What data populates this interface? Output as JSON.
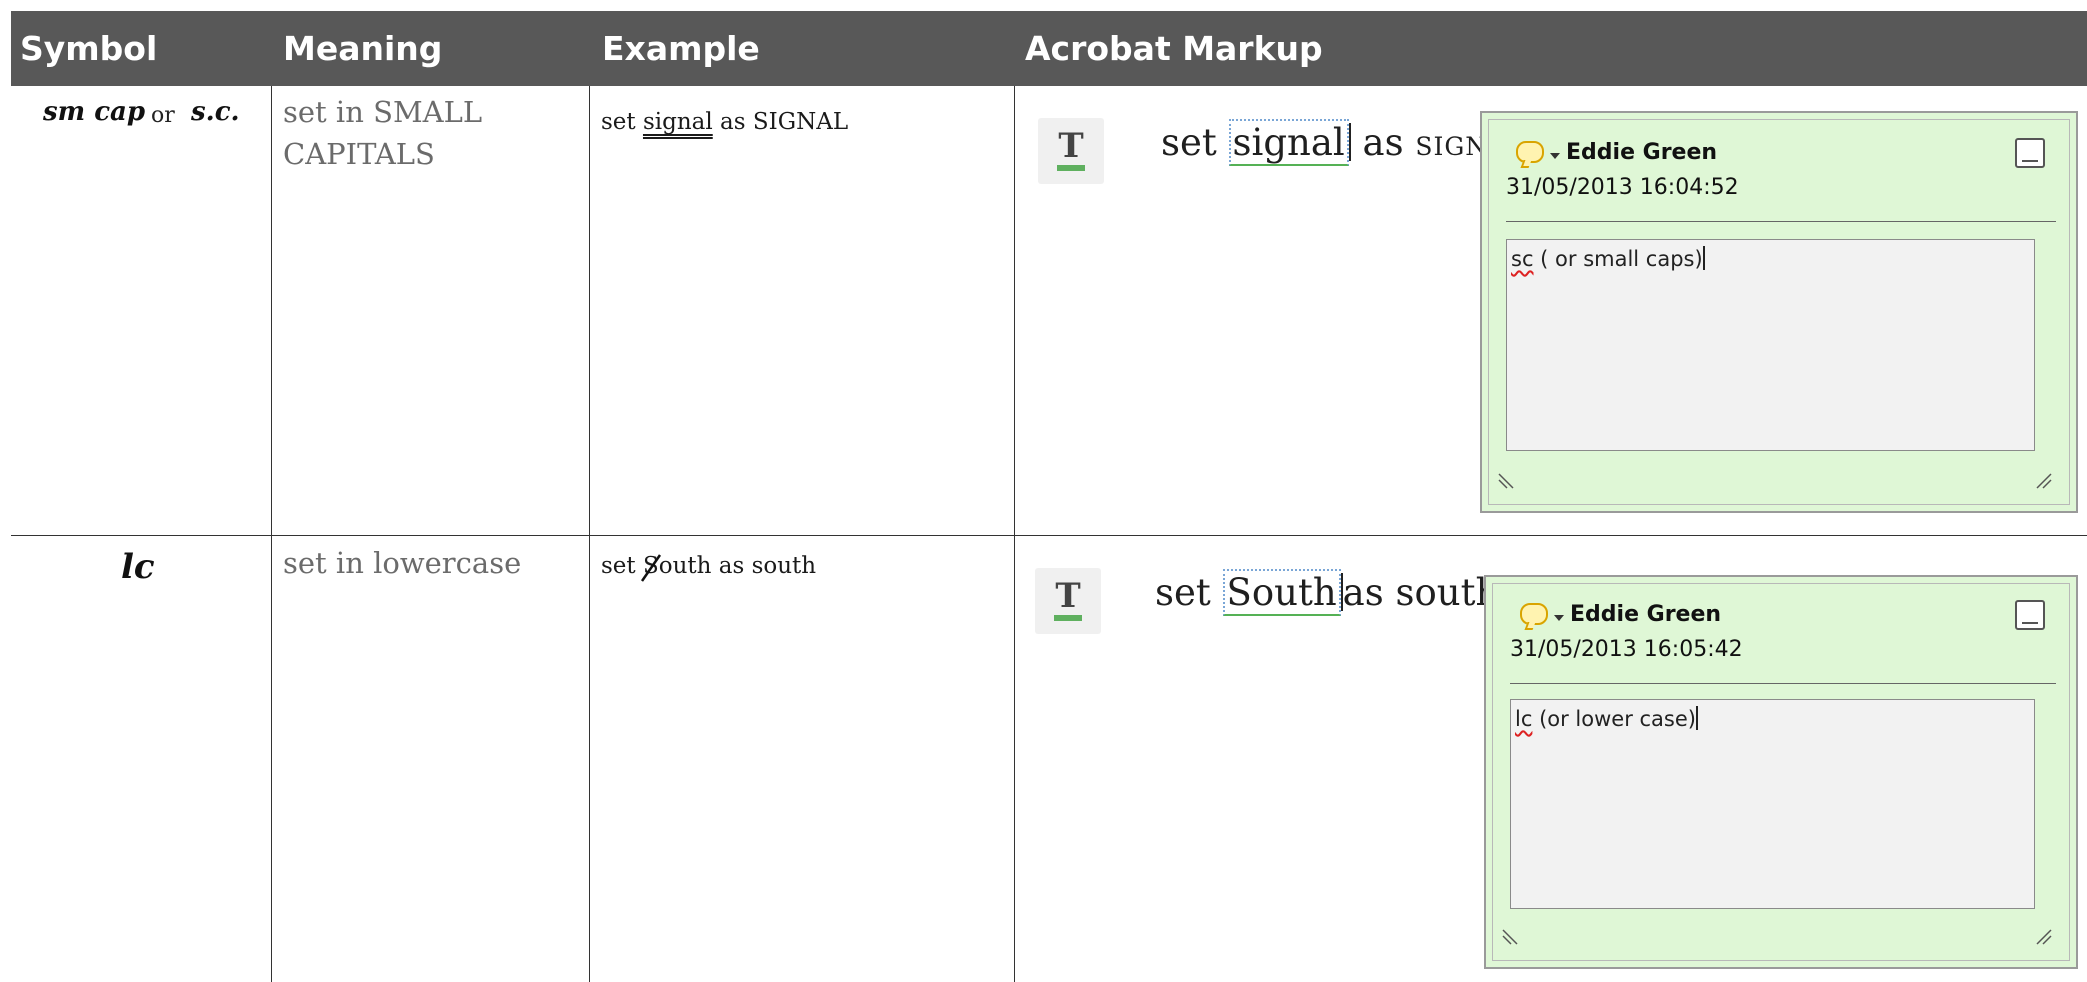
{
  "headers": {
    "symbol": "Symbol",
    "meaning": "Meaning",
    "example": "Example",
    "markup": "Acrobat Markup"
  },
  "rows": [
    {
      "symbol_main": "sm cap",
      "symbol_or": "or",
      "symbol_alt": "s.c.",
      "meaning_line1": "set in SMALL",
      "meaning_line2": "CAPITALS",
      "example_pre": "set ",
      "example_word": "signal",
      "example_post": " as SIGNAL",
      "markup_pre": "set ",
      "markup_word": "signal",
      "markup_post_as": "as ",
      "markup_post_word": "SIGNAL",
      "note": {
        "author": "Eddie Green",
        "date": "31/05/2013 16:04:52",
        "body_word": "sc",
        "body_rest": " ( or small caps)"
      }
    },
    {
      "symbol_main": "lc",
      "meaning_line1": "set in lowercase",
      "example_pre": "set ",
      "example_struck": "S",
      "example_rest": "outh as south",
      "markup_pre": "set ",
      "markup_word": "South",
      "markup_post": "as south",
      "note": {
        "author": "Eddie Green",
        "date": "31/05/2013 16:05:42",
        "body_word": "lc",
        "body_rest": " (or lower case)"
      }
    }
  ],
  "icons": {
    "tool": "text-edit-tool-icon",
    "comment": "comment-bubble-icon",
    "minimize": "minimize-icon",
    "resize": "resize-grip-icon"
  },
  "colors": {
    "header_bg": "#585858",
    "note_bg": "#dff7d6",
    "tool_green": "#5fb05f"
  }
}
